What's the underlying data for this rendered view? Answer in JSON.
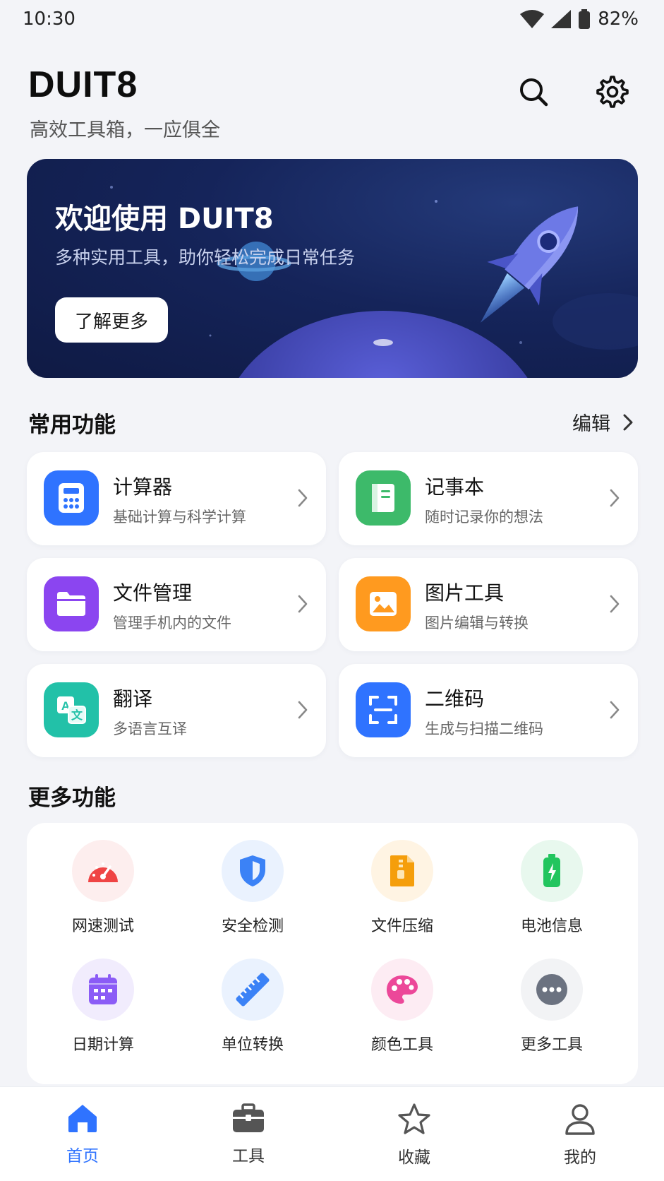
{
  "status_bar": {
    "time": "10:30",
    "battery": "82%"
  },
  "header": {
    "title": "DUIT8",
    "subtitle": "高效工具箱，一应俱全"
  },
  "banner": {
    "title": "欢迎使用 DUIT8",
    "subtitle": "多种实用工具，助你轻松完成日常任务",
    "button_label": "了解更多"
  },
  "common": {
    "title": "常用功能",
    "edit_label": "编辑",
    "items": [
      {
        "title": "计算器",
        "desc": "基础计算与科学计算",
        "icon": "calculator-icon",
        "color": "#2f73ff"
      },
      {
        "title": "记事本",
        "desc": "随时记录你的想法",
        "icon": "notebook-icon",
        "color": "#3dba6a"
      },
      {
        "title": "文件管理",
        "desc": "管理手机内的文件",
        "icon": "folder-icon",
        "color": "#8b45f0"
      },
      {
        "title": "图片工具",
        "desc": "图片编辑与转换",
        "icon": "image-icon",
        "color": "#ff9a1f"
      },
      {
        "title": "翻译",
        "desc": "多语言互译",
        "icon": "translate-icon",
        "color": "#22c1a8"
      },
      {
        "title": "二维码",
        "desc": "生成与扫描二维码",
        "icon": "qr-scan-icon",
        "color": "#2f73ff"
      }
    ]
  },
  "more": {
    "title": "更多功能",
    "items": [
      {
        "label": "网速测试",
        "icon": "speedometer-icon",
        "color": "#ef4444"
      },
      {
        "label": "安全检测",
        "icon": "shield-icon",
        "color": "#3b82f6"
      },
      {
        "label": "文件压缩",
        "icon": "zip-file-icon",
        "color": "#f59e0b"
      },
      {
        "label": "电池信息",
        "icon": "battery-icon",
        "color": "#22c55e"
      },
      {
        "label": "日期计算",
        "icon": "calendar-icon",
        "color": "#8b5cf6"
      },
      {
        "label": "单位转换",
        "icon": "ruler-icon",
        "color": "#3b82f6"
      },
      {
        "label": "颜色工具",
        "icon": "palette-icon",
        "color": "#ec4899"
      },
      {
        "label": "更多工具",
        "icon": "more-dots-icon",
        "color": "#6b7280"
      }
    ]
  },
  "bottom_nav": {
    "items": [
      {
        "label": "首页",
        "icon": "home-icon",
        "active": true
      },
      {
        "label": "工具",
        "icon": "toolbox-icon",
        "active": false
      },
      {
        "label": "收藏",
        "icon": "star-icon",
        "active": false
      },
      {
        "label": "我的",
        "icon": "user-icon",
        "active": false
      }
    ]
  },
  "colors": {
    "accent": "#2f73ff",
    "background": "#f3f4f8",
    "banner": "#15245a"
  }
}
